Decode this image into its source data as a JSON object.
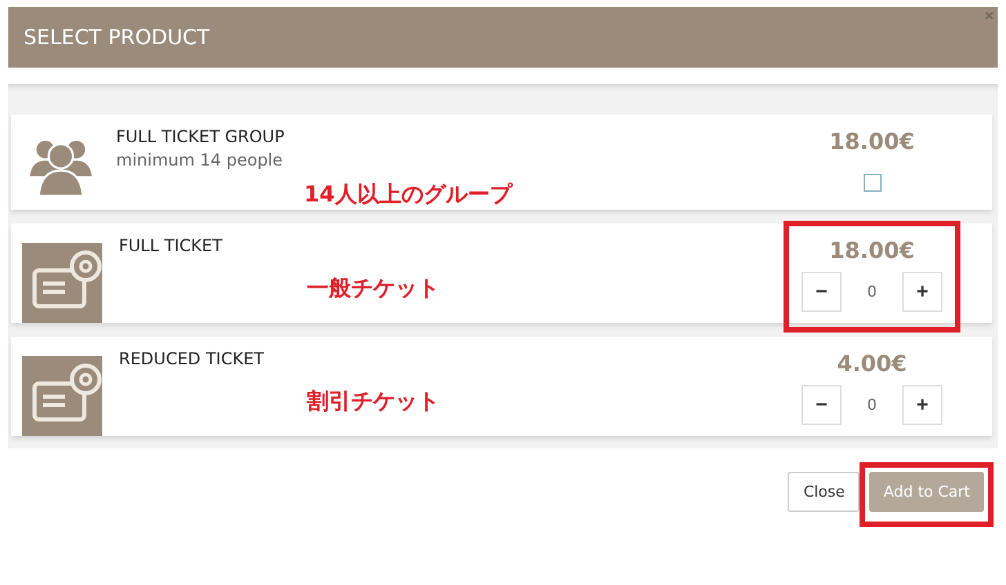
{
  "dialog": {
    "title": "SELECT PRODUCT",
    "close": "×"
  },
  "products": [
    {
      "kind": "checkbox",
      "name": "FULL TICKET GROUP",
      "subtitle": "minimum 14 people",
      "note": "14人以上のグループ",
      "price": "18.00€",
      "checked": false,
      "highlighted": false
    },
    {
      "kind": "stepper",
      "name": "FULL TICKET",
      "note": "一般チケット",
      "price": "18.00€",
      "minus": "−",
      "quantity": "0",
      "plus": "+",
      "highlighted": true
    },
    {
      "kind": "stepper",
      "name": "REDUCED TICKET",
      "note": "割引チケット",
      "price": "4.00€",
      "minus": "−",
      "quantity": "0",
      "plus": "+",
      "highlighted": false
    }
  ],
  "footer_buttons": [
    {
      "kind": "secondary",
      "label": "Close",
      "highlighted": false
    },
    {
      "kind": "primary",
      "label": "Add to Cart",
      "highlighted": true
    }
  ]
}
